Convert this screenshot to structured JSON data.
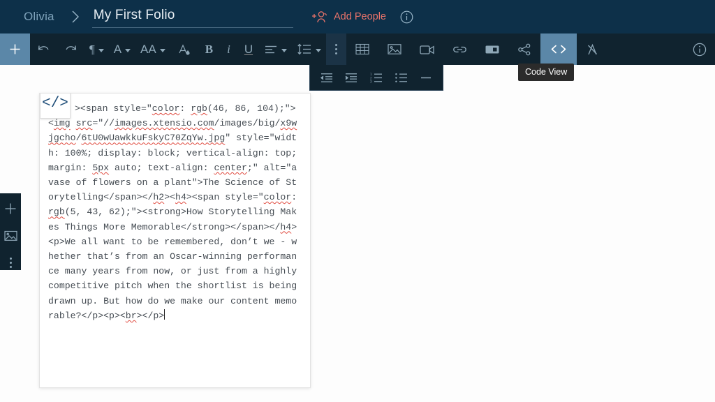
{
  "header": {
    "user": "Olivia",
    "separator_icon": "chevron-right-icon",
    "title": "My First Folio",
    "title_placeholder": "Untitled Folio",
    "add_people_label": "Add People",
    "add_people_icon": "add-person-icon",
    "info_icon": "info-circle-icon",
    "accent_color": "#e8736a",
    "bg_color": "#0d3049"
  },
  "toolbar": {
    "bg_color": "#10232f",
    "active_color": "#5b87a8",
    "buttons": [
      {
        "name": "add-block-button",
        "icon": "plus-icon",
        "label": "+",
        "state": "highlight"
      },
      {
        "name": "undo-button",
        "icon": "undo-arrow-icon",
        "label": "",
        "state": "normal"
      },
      {
        "name": "redo-button",
        "icon": "redo-arrow-icon",
        "label": "",
        "state": "normal"
      },
      {
        "name": "paragraph-style-button",
        "icon": "pilcrow-icon",
        "label": "¶",
        "state": "normal",
        "caret": true
      },
      {
        "name": "font-family-button",
        "icon": "font-a-icon",
        "label": "A",
        "state": "normal",
        "caret": true
      },
      {
        "name": "font-size-button",
        "icon": "font-size-aa-icon",
        "label": "AA",
        "state": "normal",
        "caret": true
      },
      {
        "name": "text-color-button",
        "icon": "font-color-drop-icon",
        "label": "A",
        "state": "normal"
      },
      {
        "name": "bold-button",
        "icon": "bold-b-icon",
        "label": "B",
        "state": "normal"
      },
      {
        "name": "italic-button",
        "icon": "italic-i-icon",
        "label": "i",
        "state": "normal"
      },
      {
        "name": "underline-button",
        "icon": "underline-u-icon",
        "label": "U",
        "state": "normal"
      },
      {
        "name": "align-button",
        "icon": "align-left-icon",
        "label": "",
        "state": "normal",
        "caret": true
      },
      {
        "name": "line-height-button",
        "icon": "line-height-icon",
        "label": "",
        "state": "normal",
        "caret": true
      },
      {
        "name": "more-options-button",
        "icon": "vertical-dots-icon",
        "label": "",
        "state": "dim"
      },
      {
        "name": "insert-table-button",
        "icon": "table-grid-icon",
        "label": "",
        "state": "normal"
      },
      {
        "name": "insert-image-button",
        "icon": "image-picture-icon",
        "label": "",
        "state": "normal"
      },
      {
        "name": "insert-video-button",
        "icon": "video-camera-icon",
        "label": "",
        "state": "normal"
      },
      {
        "name": "insert-link-button",
        "icon": "chain-link-icon",
        "label": "",
        "state": "normal"
      },
      {
        "name": "insert-embed-button",
        "icon": "embed-box-icon",
        "label": "",
        "state": "normal"
      },
      {
        "name": "share-button",
        "icon": "share-nodes-icon",
        "label": "",
        "state": "normal"
      },
      {
        "name": "code-view-button",
        "icon": "code-angle-brackets-icon",
        "label": "",
        "state": "highlight"
      },
      {
        "name": "clear-formatting-button",
        "icon": "clear-format-a-icon",
        "label": "",
        "state": "normal"
      }
    ],
    "info_icon": "info-circle-icon"
  },
  "toolbar_overflow": {
    "buttons": [
      {
        "name": "outdent-button",
        "icon": "outdent-icon"
      },
      {
        "name": "indent-button",
        "icon": "indent-icon"
      },
      {
        "name": "ordered-list-button",
        "icon": "numbered-list-icon"
      },
      {
        "name": "unordered-list-button",
        "icon": "bullet-list-icon"
      },
      {
        "name": "horizontal-rule-button",
        "icon": "horizontal-line-icon"
      }
    ]
  },
  "tooltip": {
    "text": "Code View",
    "bg_color": "#2b2b2b"
  },
  "sidebar": {
    "buttons": [
      {
        "name": "sidebar-add-button",
        "icon": "plus-icon"
      },
      {
        "name": "sidebar-image-button",
        "icon": "image-picture-icon"
      },
      {
        "name": "sidebar-more-button",
        "icon": "vertical-dots-icon"
      }
    ]
  },
  "editor": {
    "code_view_icon": "code-angle-brackets-icon",
    "code_view_glyph": "</>",
    "code": ">FOLDED<",
    "code_lines": [
      "><span style=\"color: rgb(46, 86, 104);\"><img src=\"//images.xtensio.com/images/big/x9wjgcho/6tU0wUawkkuFskyC70ZqYw.jpg\" style=\"width: 100%; display: block; vertical-align: top; margin: 5px auto; text-align: center;\" alt=\"a vase of flowers on a plant\">The Science of Storytelling</span></h2><h4><span style=\"color: rgb(5, 43, 62);\"><strong>How Storytelling Makes Things More Memorable</strong></span></h4><p>We all want to be remembered, don’t we - whether that’s from an Oscar-winning performance many years from now, or just from a highly competitive pitch when the shortlist is being drawn up. But how do we make our content memorable?</p><p><br></p>"
    ],
    "segments": [
      {
        "t": "><span style=\"",
        "s": "plain"
      },
      {
        "t": "color",
        "s": "sq"
      },
      {
        "t": ": ",
        "s": "plain"
      },
      {
        "t": "rgb",
        "s": "sq"
      },
      {
        "t": "(46, 86, 104);\"><",
        "s": "plain"
      },
      {
        "t": "img",
        "s": "sq"
      },
      {
        "t": " ",
        "s": "plain"
      },
      {
        "t": "src",
        "s": "sq"
      },
      {
        "t": "=\"//",
        "s": "plain"
      },
      {
        "t": "images.xtensio.com",
        "s": "sq"
      },
      {
        "t": "/images/big/",
        "s": "plain"
      },
      {
        "t": "x9wjgcho",
        "s": "sq"
      },
      {
        "t": "/",
        "s": "plain"
      },
      {
        "t": "6tU0wUawkkuFskyC70ZqYw.jpg",
        "s": "sq"
      },
      {
        "t": "\" style=\"width: 100%; display: block; vertical-align: top; margin: ",
        "s": "plain"
      },
      {
        "t": "5px",
        "s": "sq"
      },
      {
        "t": " auto; text-align: ",
        "s": "plain"
      },
      {
        "t": "center",
        "s": "sq"
      },
      {
        "t": ";\" alt=\"a vase of flowers on a plant\">The Science of Storytelling</span></",
        "s": "plain"
      },
      {
        "t": "h2",
        "s": "sq"
      },
      {
        "t": "><",
        "s": "plain"
      },
      {
        "t": "h4",
        "s": "sq"
      },
      {
        "t": "><span style=\"",
        "s": "plain"
      },
      {
        "t": "color",
        "s": "sq"
      },
      {
        "t": ": ",
        "s": "plain"
      },
      {
        "t": "rgb",
        "s": "sq"
      },
      {
        "t": "(5, 43, 62);\"><strong>How Storytelling Makes Things More Memorable</strong></span></",
        "s": "plain"
      },
      {
        "t": "h4",
        "s": "sq"
      },
      {
        "t": "><p>We all want to be remembered, don’t we - whether that’s from an Oscar-winning performance many years from now, or just from a highly competitive pitch when the shortlist is being drawn up. But how do we make our content memorable?</p><p><",
        "s": "plain"
      },
      {
        "t": "br",
        "s": "sq"
      },
      {
        "t": "></p>",
        "s": "plain"
      }
    ]
  }
}
